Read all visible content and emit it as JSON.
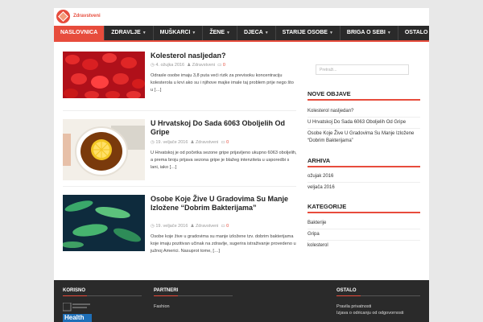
{
  "site": {
    "name": "Zdravstveni"
  },
  "nav": [
    {
      "label": "NASLOVNICA",
      "active": true,
      "dropdown": false
    },
    {
      "label": "ZDRAVLJE",
      "active": false,
      "dropdown": true
    },
    {
      "label": "MUŠKARCI",
      "active": false,
      "dropdown": true
    },
    {
      "label": "ŽENE",
      "active": false,
      "dropdown": true
    },
    {
      "label": "DJECA",
      "active": false,
      "dropdown": true
    },
    {
      "label": "STARIJE OSOBE",
      "active": false,
      "dropdown": true
    },
    {
      "label": "BRIGA O SEBI",
      "active": false,
      "dropdown": true
    },
    {
      "label": "OSTALO",
      "active": false,
      "dropdown": true
    }
  ],
  "posts": [
    {
      "title": "Kolesterol nasljedan?",
      "date": "4. ožujka 2016",
      "author": "Zdravstveni",
      "comments": "0",
      "excerpt": "Odrasle osobe imaju 3,8 puta veći rizik za previsoku koncentraciju kolesterola u krvi ako su i njihove majke imale taj problem prije nego što u […]"
    },
    {
      "title": "U Hrvatskoj Do Sada 6063 Oboljelih Od Gripe",
      "date": "19. veljače 2016",
      "author": "Zdravstveni",
      "comments": "0",
      "excerpt": "U Hrvatskoj je od početka sezone gripe prijavljeno ukupno 6063 oboljelih, a prema broju prijava sezona gripe je blažeg intenziteta u usporedbi s lani, iako […]"
    },
    {
      "title": "Osobe Koje Žive U Gradovima Su Manje Izložene “Dobrim Bakterijama”",
      "date": "19. veljače 2016",
      "author": "Zdravstveni",
      "comments": "0",
      "excerpt": "Osobe koje žive u gradovima su manje izložene tzv. dobrim bakterijama koje imaju pozitivan učinak na zdravlje, sugerira istraživanje provedeno u južnoj Americi. Nasuprot tome, […]"
    }
  ],
  "sidebar": {
    "search_placeholder": "Pretraži...",
    "recent_title": "NOVE OBJAVE",
    "recent": [
      "Kolesterol nasljedan?",
      "U Hrvatskoj Do Sada 6063 Oboljelih Od Gripe",
      "Osobe Koje Žive U Gradovima Su Manje Izložene “Dobrim Bakterijama”"
    ],
    "archive_title": "ARHIVA",
    "archive": [
      "ožujak 2016",
      "veljača 2016"
    ],
    "categories_title": "KATEGORIJE",
    "categories": [
      "Bakterije",
      "Gripa",
      "kolesterol"
    ]
  },
  "footer": {
    "col1_title": "KORISNO",
    "badge_text": "Health",
    "col2_title": "PARTNERI",
    "partners": [
      "Fashion"
    ],
    "col3_title": "OSTALO",
    "links": [
      "Pravila privatnosti",
      "Izjava o odricanju od odgovornosti"
    ]
  },
  "colors": {
    "accent": "#e74c3c",
    "nav_bg": "#2a2a2a",
    "footer_bg": "#2a2a2a"
  }
}
